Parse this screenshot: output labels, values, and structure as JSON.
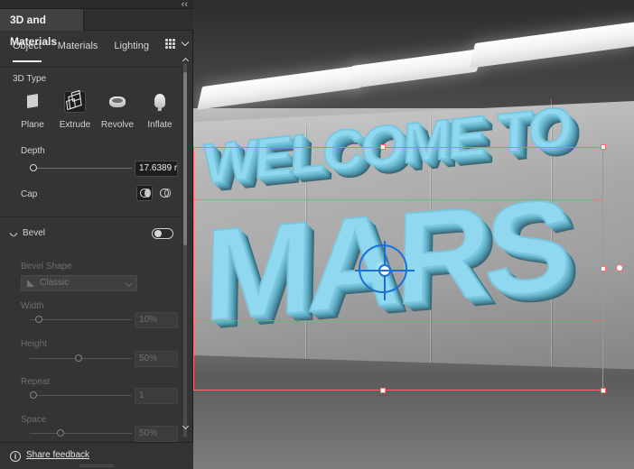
{
  "panel": {
    "title": "3D and Materials",
    "collapse_icon": "double-chevron-left-icon",
    "tabs": [
      {
        "label": "Object",
        "active": true
      },
      {
        "label": "Materials",
        "active": false
      },
      {
        "label": "Lighting",
        "active": false
      }
    ],
    "tab_tools": {
      "grid_icon": "render-grid-icon",
      "chevron_icon": "chevron-down-icon"
    },
    "section_3d_type": {
      "title": "3D Type",
      "options": [
        {
          "label": "Plane",
          "icon": "plane-icon",
          "selected": false
        },
        {
          "label": "Extrude",
          "icon": "extrude-icon",
          "selected": true
        },
        {
          "label": "Revolve",
          "icon": "revolve-icon",
          "selected": false
        },
        {
          "label": "Inflate",
          "icon": "inflate-icon",
          "selected": false
        }
      ]
    },
    "depth": {
      "label": "Depth",
      "value": "17.6389 r"
    },
    "cap": {
      "label": "Cap"
    },
    "bevel": {
      "label": "Bevel",
      "enabled": false,
      "shape_label": "Bevel Shape",
      "shape_value": "Classic",
      "width_label": "Width",
      "width_value": "10%",
      "height_label": "Height",
      "height_value": "50%",
      "repeat_label": "Repeat",
      "repeat_value": "1",
      "space_label": "Space",
      "space_value": "50%"
    },
    "footer": {
      "info_icon": "info-icon",
      "link": "Share feedback"
    }
  },
  "artwork": {
    "line1": "WELCOME TO",
    "line2": "MARS"
  },
  "colors": {
    "panel_bg": "#343434",
    "text_primary": "#d7d7d7",
    "text_disabled": "#6e6e6e",
    "selection_red": "#ff6d6d",
    "widget_blue": "#1a70d8",
    "text_face": "#8fd8ef"
  },
  "icons": {
    "canvas_widget": "rotation-widget-icon"
  }
}
